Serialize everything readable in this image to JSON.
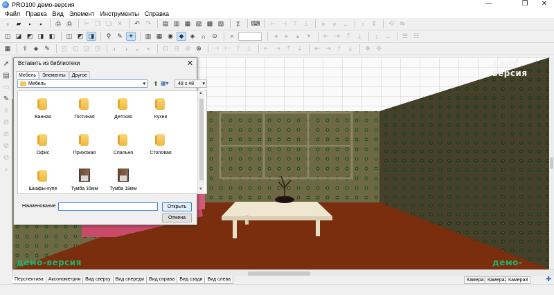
{
  "window": {
    "title": "PRO100 демо-версия",
    "minimize": "—",
    "maximize": "❐",
    "close": "✕"
  },
  "menu": [
    "Файл",
    "Правка",
    "Вид",
    "Элемент",
    "Инструменты",
    "Справка"
  ],
  "viewport": {
    "watermark": "демо-версия",
    "floor_color": "#7a2e0e",
    "wall_color": "#6f6a46",
    "accent_color": "#1fb36b"
  },
  "view_tabs": [
    "Перспектива",
    "Аксонометрия",
    "Вид сверху",
    "Вид спереди",
    "Вид справа",
    "Вид сзади",
    "Вид слева"
  ],
  "camera_tabs": [
    "Камера1",
    "Камера2",
    "Камера3"
  ],
  "dialog": {
    "title": "Вставить из библиотеки",
    "close": "✕",
    "tabs": [
      "Мебель",
      "Элементы",
      "Другое"
    ],
    "path": "Мебель",
    "size": "48 x 48",
    "items": [
      {
        "label": "Ванная",
        "icon": "folder-icon"
      },
      {
        "label": "Гостиная",
        "icon": "folder-icon"
      },
      {
        "label": "Детская",
        "icon": "folder-icon"
      },
      {
        "label": "Кухни",
        "icon": "folder-icon"
      },
      {
        "label": "Офис",
        "icon": "folder-icon"
      },
      {
        "label": "Прихожая",
        "icon": "folder-icon"
      },
      {
        "label": "Спальня",
        "icon": "folder-icon"
      },
      {
        "label": "Столовая",
        "icon": "folder-icon"
      },
      {
        "label": "Шкафы-купе",
        "icon": "folder-icon"
      },
      {
        "label": "Тумба 16мм",
        "icon": "cabinet-icon"
      },
      {
        "label": "Тумба 18мм",
        "icon": "cabinet-icon"
      }
    ],
    "name_label": "Наименование",
    "name_value": "",
    "open_button": "Открыть",
    "cancel_button": "Отмена"
  }
}
